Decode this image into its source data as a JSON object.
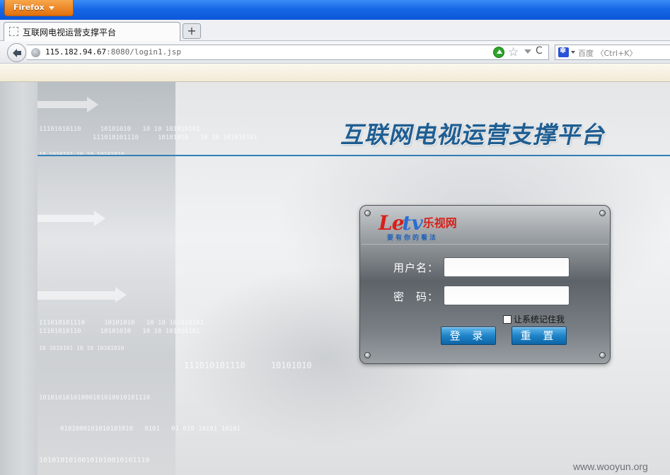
{
  "browser": {
    "menu_label": "Firefox",
    "tab_title": "互联网电视运营支撑平台",
    "new_tab_symbol": "+",
    "url_host": "115.182.94.67",
    "url_rest": ":8080/login1.jsp",
    "search_placeholder": "百度 〈Ctrl+K〉",
    "reload_symbol": "C",
    "star_symbol": "☆"
  },
  "page": {
    "title": "互联网电视运营支撑平台",
    "binary_texts": [
      "11101010110     10101010   10 10 101010101",
      "              111010101110     10101010   10 10 101010101",
      "10 1010101 10 10 10101010",
      "111010101110     10101010   10 10 101010101",
      "11101010110     10101010   10 10 101010101",
      "10 1010101 10 10 10101010",
      "111010101110     10101010",
      "10101010101000101010010101110",
      "0101000101010101010   0101   01 010 10101 10101",
      "10101010100101010010101110"
    ],
    "watermark": "www.wooyun.org"
  },
  "login": {
    "logo_le": "Le",
    "logo_tv": "tv",
    "logo_cn": "乐视网",
    "logo_slogan": "要有你的看法",
    "username_label": "用户名：",
    "password_label": "密　码：",
    "remember_label": "让系统记住我",
    "login_button": "登 录",
    "reset_button": "重 置"
  },
  "colors": {
    "title_blue": "#1f5e92",
    "button_blue": "#1f84c8",
    "firefox_orange": "#e2700c"
  }
}
